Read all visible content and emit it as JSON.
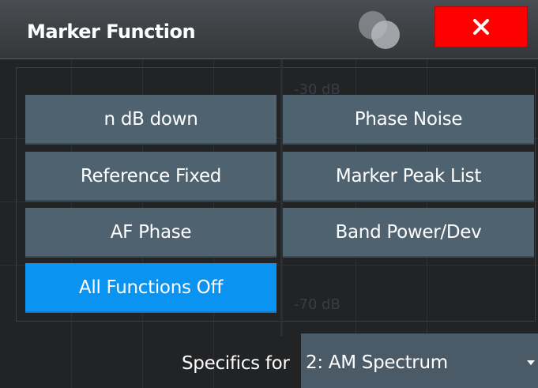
{
  "dialog": {
    "title": "Marker Function",
    "close_icon": "close-x-icon"
  },
  "background": {
    "labels": [
      "-30 dB",
      "-70 dB"
    ]
  },
  "functions": [
    {
      "label": "n dB down",
      "active": false
    },
    {
      "label": "Phase Noise",
      "active": false
    },
    {
      "label": "Reference Fixed",
      "active": false
    },
    {
      "label": "Marker Peak List",
      "active": false
    },
    {
      "label": "AF Phase",
      "active": false
    },
    {
      "label": "Band Power/Dev",
      "active": false
    },
    {
      "label": "All Functions Off",
      "active": true
    }
  ],
  "specifics": {
    "label": "Specifics for",
    "selected": "2: AM Spectrum"
  },
  "colors": {
    "button": "#4f6270",
    "active_button": "#0b93f2",
    "close": "#ff0000"
  }
}
